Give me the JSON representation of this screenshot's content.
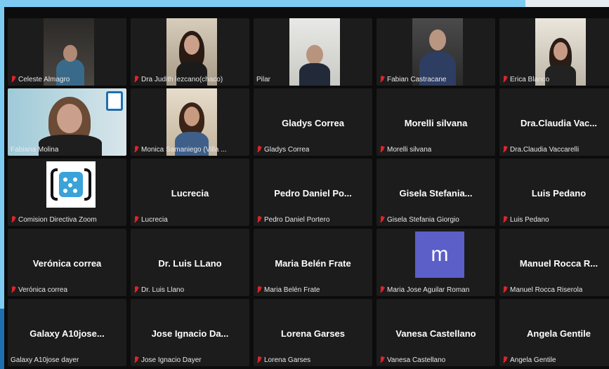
{
  "colors": {
    "accent": "#7ecbf2",
    "muted_mic": "#e0242b",
    "tile_bg": "#1c1c1c",
    "avatar_bg": "#5b5fc7"
  },
  "participants": [
    {
      "label": "Celeste Almagro",
      "display": "video",
      "muted": true
    },
    {
      "label": "Dra Judith lezcano(chaco)",
      "display": "video",
      "muted": true
    },
    {
      "label": "Pilar",
      "display": "video",
      "muted": false
    },
    {
      "label": "Fabian Castracane",
      "display": "video",
      "muted": true
    },
    {
      "label": "Erica Blanco",
      "display": "video",
      "muted": true
    },
    {
      "label": "Fabiana Molina",
      "display": "video",
      "muted": false
    },
    {
      "label": "Monica Samaniego (Villa ...",
      "display": "video",
      "muted": true
    },
    {
      "name": "Gladys Correa",
      "label": "Gladys Correa",
      "display": "name",
      "muted": true
    },
    {
      "name": "Morelli silvana",
      "label": "Morelli silvana",
      "display": "name",
      "muted": true
    },
    {
      "name": "Dra.Claudia  Vac...",
      "label": "Dra.Claudia Vaccarelli",
      "display": "name",
      "muted": true
    },
    {
      "label": "Comision Directiva Zoom",
      "display": "logo",
      "muted": true
    },
    {
      "name": "Lucrecia",
      "label": "Lucrecia",
      "display": "name",
      "muted": true
    },
    {
      "name": "Pedro  Daniel  Po...",
      "label": "Pedro Daniel Portero",
      "display": "name",
      "muted": true
    },
    {
      "name": "Gisela  Stefania...",
      "label": "Gisela Stefania Giorgio",
      "display": "name",
      "muted": true
    },
    {
      "name": "Luis Pedano",
      "label": "Luis Pedano",
      "display": "name",
      "muted": true
    },
    {
      "name": "Verónica correa",
      "label": "Verónica correa",
      "display": "name",
      "muted": true
    },
    {
      "name": "Dr. Luis LLano",
      "label": "Dr. Luis Llano",
      "display": "name",
      "muted": true
    },
    {
      "name": "Maria Belén Frate",
      "label": "Maria Belén Frate",
      "display": "name",
      "muted": true
    },
    {
      "avatar_letter": "m",
      "label": "Maria Jose Aguilar Roman",
      "display": "avatar",
      "muted": true
    },
    {
      "name": "Manuel  Rocca  R...",
      "label": "Manuel Rocca Riserola",
      "display": "name",
      "muted": true
    },
    {
      "name": "Galaxy  A10jose...",
      "label": "Galaxy A10jose dayer",
      "display": "name",
      "muted": false
    },
    {
      "name": "Jose Ignacio Da...",
      "label": "Jose Ignacio Dayer",
      "display": "name",
      "muted": true
    },
    {
      "name": "Lorena Garses",
      "label": "Lorena Garses",
      "display": "name",
      "muted": true
    },
    {
      "name": "Vanesa Castellano",
      "label": "Vanesa Castellano",
      "display": "name",
      "muted": true
    },
    {
      "name": "Angela Gentile",
      "label": "Angela Gentile",
      "display": "name",
      "muted": true
    }
  ]
}
